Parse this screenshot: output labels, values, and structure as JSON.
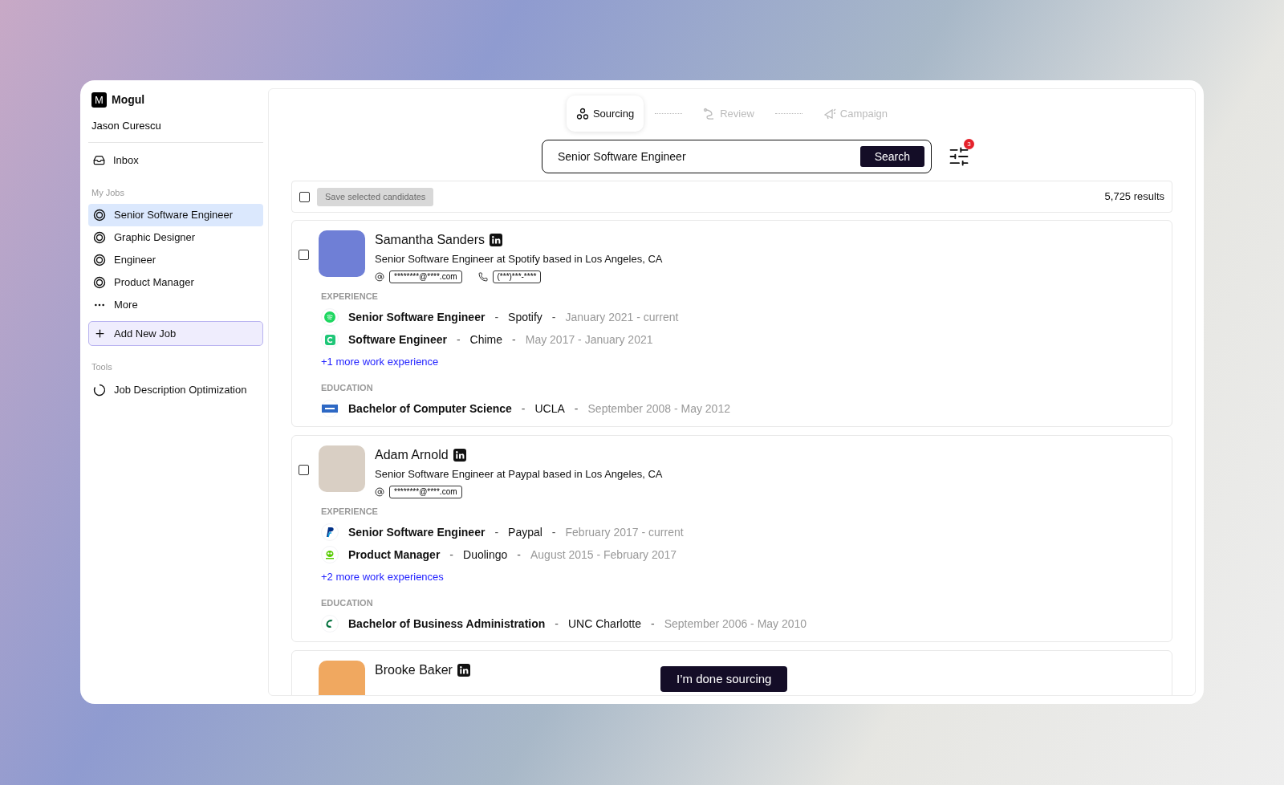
{
  "sidebar": {
    "brand": {
      "initial": "M",
      "name": "Mogul"
    },
    "user": "Jason Curescu",
    "nav": [
      {
        "label": "Inbox",
        "selected": false
      }
    ],
    "my_jobs": {
      "heading": "My Jobs",
      "items": [
        {
          "label": "Senior Software Engineer",
          "kind": "job",
          "selected": true
        },
        {
          "label": "Graphic Designer",
          "kind": "job",
          "selected": false
        },
        {
          "label": "Engineer",
          "kind": "job",
          "selected": false
        },
        {
          "label": "Product Manager",
          "kind": "job",
          "selected": false
        },
        {
          "label": "More",
          "kind": "more",
          "selected": false
        }
      ]
    },
    "add_job": "Add New Job",
    "tools": {
      "heading": "Tools",
      "items": [
        {
          "label": "Job Description Optimization"
        }
      ]
    }
  },
  "steps": [
    {
      "label": "Sourcing",
      "kind": "sourcing",
      "selected": true
    },
    {
      "label": "Review",
      "kind": "review",
      "selected": false
    },
    {
      "label": "Campaign",
      "kind": "campaign",
      "selected": false
    }
  ],
  "search": {
    "value": "Senior Software Engineer",
    "button": "Search"
  },
  "filter": {
    "badge": "3"
  },
  "toolbar": {
    "checked": false,
    "save_button": {
      "label": "Save selected candidates",
      "disabled": true
    },
    "results": "5,725 results"
  },
  "candidates": [
    {
      "name": "Samantha Sanders",
      "checked": false,
      "headline": "Senior Software Engineer at Spotify based in Los Angeles, CA",
      "email": "********@****.com",
      "phone": "(***)***-****",
      "experience_heading": "EXPERIENCE",
      "experience": [
        {
          "title": "Senior Software Engineer",
          "separators": [
            "-",
            "-"
          ],
          "company": "Spotify",
          "dates": "January 2021 - current",
          "kind": "spotify"
        },
        {
          "title": "Software Engineer",
          "separators": [
            "-",
            "-"
          ],
          "company": "Chime",
          "dates": "May 2017 - January 2021",
          "kind": "chime"
        }
      ],
      "more_link": "+1 more work experience",
      "education_heading": "EDUCATION",
      "education": [
        {
          "degree": "Bachelor of Computer Science",
          "separators": [
            "-",
            "-"
          ],
          "school": "UCLA",
          "dates": "September 2008 - May 2012",
          "kind": "ucla"
        }
      ]
    },
    {
      "name": "Adam Arnold",
      "checked": false,
      "headline": "Senior Software Engineer at Paypal based in Los Angeles, CA",
      "email": "********@****.com",
      "experience_heading": "EXPERIENCE",
      "experience": [
        {
          "title": "Senior Software Engineer",
          "separators": [
            "-",
            "-"
          ],
          "company": "Paypal",
          "dates": "February 2017 - current",
          "kind": "paypal"
        },
        {
          "title": "Product Manager",
          "separators": [
            "-",
            "-"
          ],
          "company": "Duolingo",
          "dates": "August 2015 - February 2017",
          "kind": "duolingo"
        }
      ],
      "more_link": "+2 more work experiences",
      "education_heading": "EDUCATION",
      "education": [
        {
          "degree": "Bachelor of Business Administration",
          "separators": [
            "-",
            "-"
          ],
          "school": "UNC Charlotte",
          "dates": "September 2006 - May 2010",
          "kind": "unc"
        }
      ]
    },
    {
      "name": "Brooke Baker"
    }
  ],
  "done_button": "I’m done sourcing"
}
